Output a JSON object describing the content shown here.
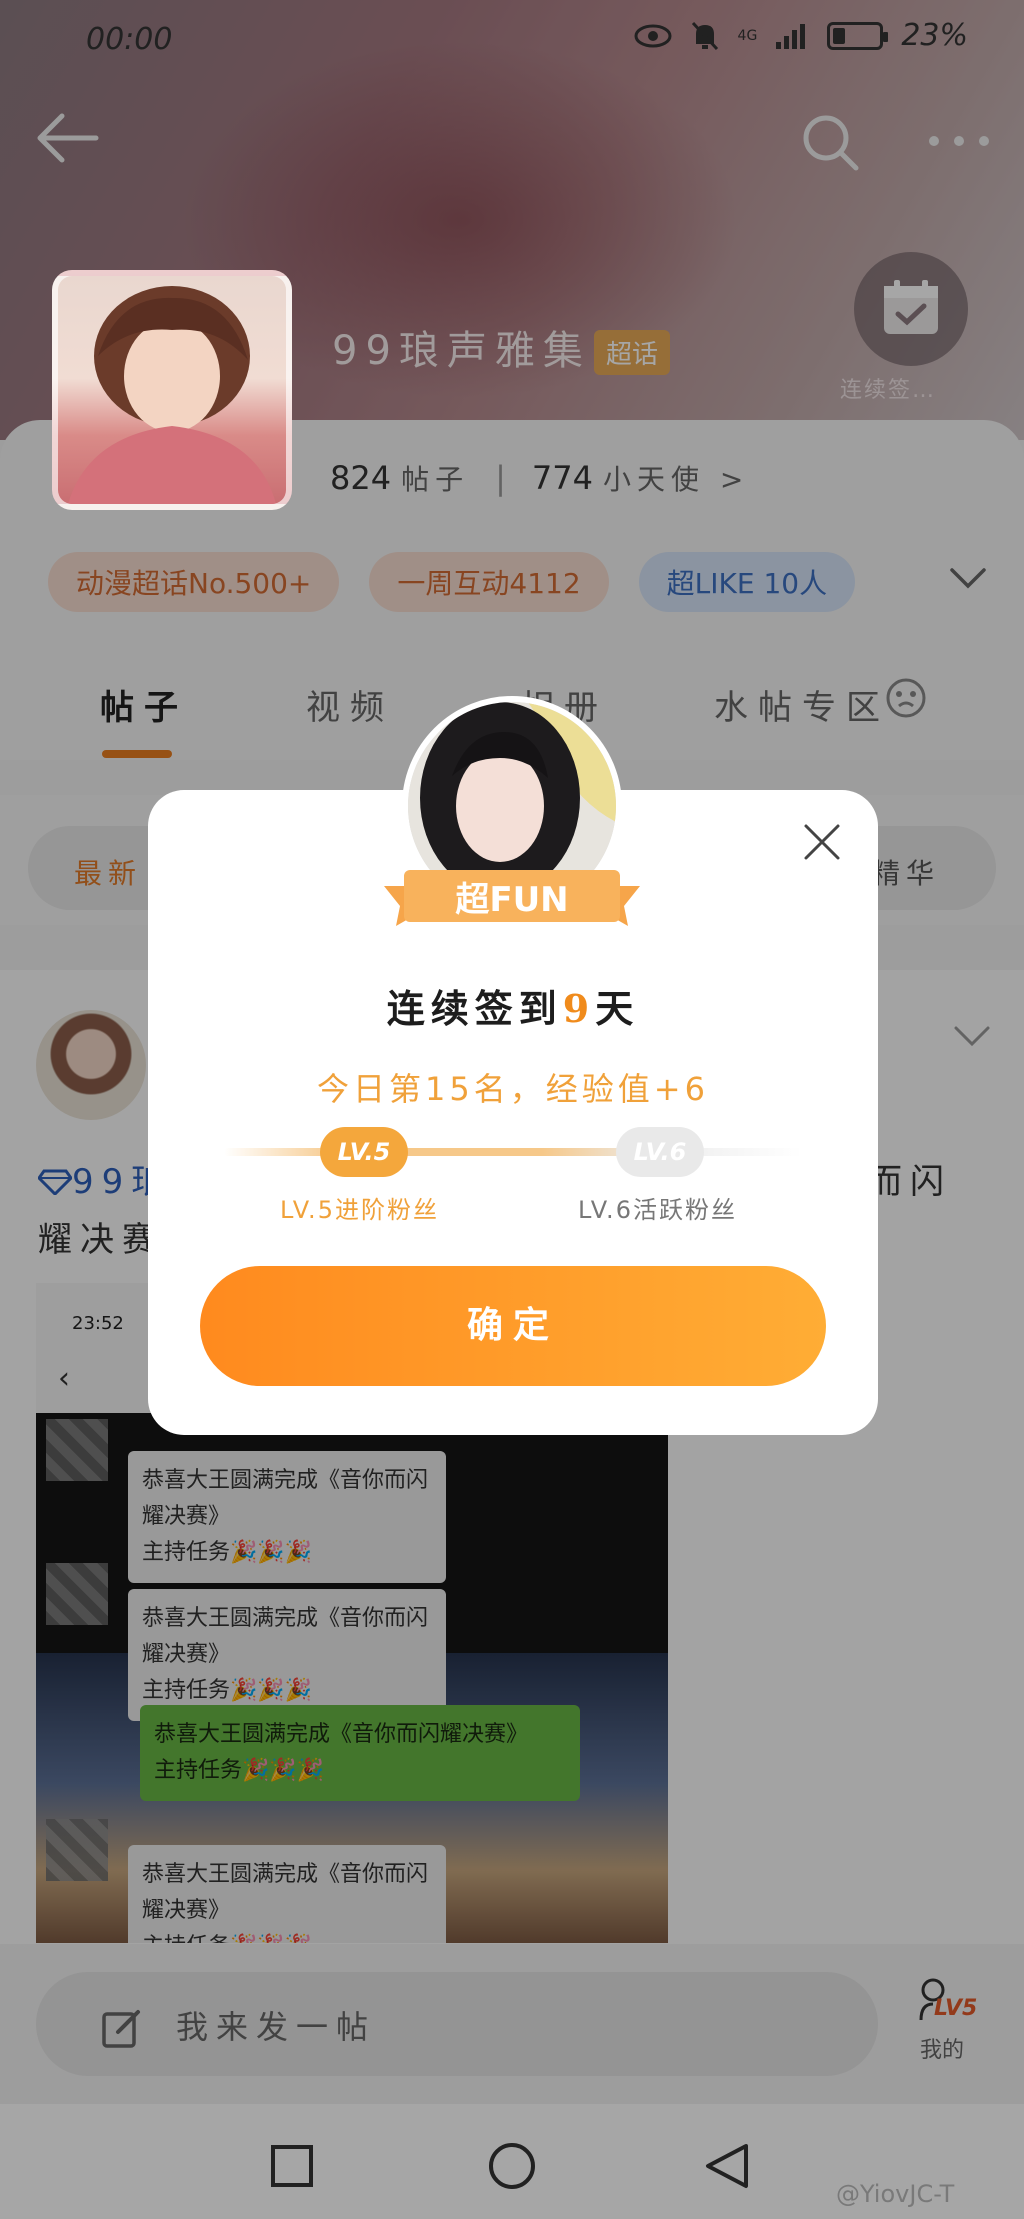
{
  "status_bar": {
    "time": "00:00",
    "network": "4G",
    "battery": "23%"
  },
  "header": {
    "title": "99琅声雅集",
    "tag": "超话",
    "checkin_label": "连续签…",
    "posts_count": "824",
    "posts_label": "帖子",
    "angels_count": "774",
    "angels_label": "小天使 >"
  },
  "chips": [
    "动漫超话No.500+",
    "一周互动4112",
    "超LIKE 10人"
  ],
  "tabs": [
    "帖子",
    "视频",
    "相册",
    "水帖专区"
  ],
  "sort": {
    "left": "最新",
    "right": "精华"
  },
  "post": {
    "line1_prefix": "99琅",
    "line1_suffix": "而闪",
    "line2": "耀决赛",
    "screenshot_time": "23:52",
    "bubble_text_1": "恭喜大王圆满完成《音你而闪耀决赛》",
    "bubble_text_2": "主持任务🎉🎉🎉",
    "bubble_text_3": "恭喜大王圆满完成《音你而闪耀决赛》"
  },
  "composer": {
    "placeholder": "我来发一帖",
    "level_badge": "LV5",
    "mine": "我的"
  },
  "modal": {
    "ribbon": "超FUN",
    "title_prefix": "连续签到",
    "title_num": "9",
    "title_suffix": "天",
    "subtitle": "今日第15名，经验值+6",
    "lv_current": "LV.5",
    "lv_next": "LV.6",
    "lv_current_label": "LV.5进阶粉丝",
    "lv_next_label": "LV.6活跃粉丝",
    "confirm": "确定"
  },
  "watermark": "@YiovJC-T",
  "colors": {
    "accent": "#f08b1c",
    "button_start": "#ff8a1e",
    "button_end": "#ffad35",
    "chip_blue": "#3d6fc0"
  }
}
